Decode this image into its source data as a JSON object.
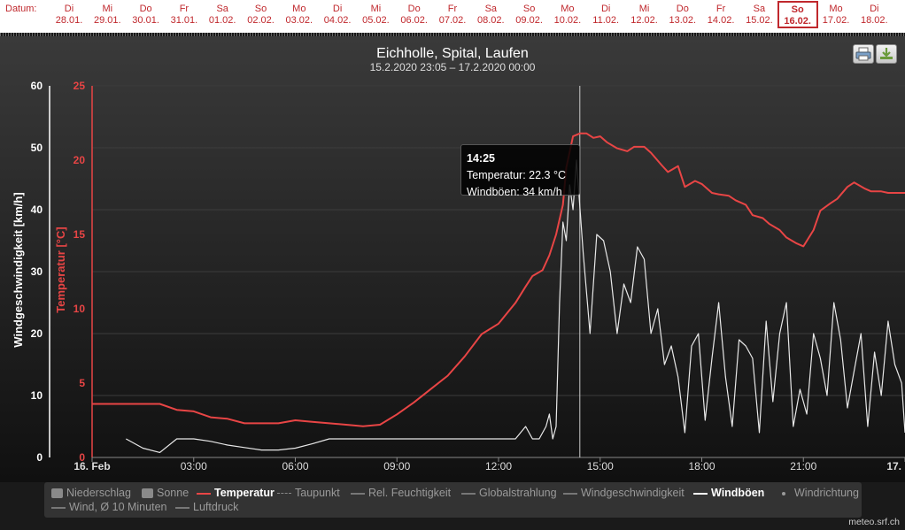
{
  "datebar": {
    "label": "Datum:",
    "days": [
      {
        "wd": "Di",
        "date": "28.01."
      },
      {
        "wd": "Mi",
        "date": "29.01."
      },
      {
        "wd": "Do",
        "date": "30.01."
      },
      {
        "wd": "Fr",
        "date": "31.01."
      },
      {
        "wd": "Sa",
        "date": "01.02."
      },
      {
        "wd": "So",
        "date": "02.02."
      },
      {
        "wd": "Mo",
        "date": "03.02."
      },
      {
        "wd": "Di",
        "date": "04.02."
      },
      {
        "wd": "Mi",
        "date": "05.02."
      },
      {
        "wd": "Do",
        "date": "06.02."
      },
      {
        "wd": "Fr",
        "date": "07.02."
      },
      {
        "wd": "Sa",
        "date": "08.02."
      },
      {
        "wd": "So",
        "date": "09.02."
      },
      {
        "wd": "Mo",
        "date": "10.02."
      },
      {
        "wd": "Di",
        "date": "11.02."
      },
      {
        "wd": "Mi",
        "date": "12.02."
      },
      {
        "wd": "Do",
        "date": "13.02."
      },
      {
        "wd": "Fr",
        "date": "14.02."
      },
      {
        "wd": "Sa",
        "date": "15.02."
      },
      {
        "wd": "So",
        "date": "16.02."
      },
      {
        "wd": "Mo",
        "date": "17.02."
      },
      {
        "wd": "Di",
        "date": "18.02."
      }
    ],
    "selected": "16.02."
  },
  "tooltip": {
    "time": "14:25",
    "line1": "Temperatur: 22.3 °C",
    "line2": "Windböen: 34 km/h"
  },
  "legend": [
    {
      "name": "Niederschlag",
      "marker": "box",
      "active": false
    },
    {
      "name": "Sonne",
      "marker": "box",
      "active": false
    },
    {
      "name": "Temperatur",
      "marker": "line",
      "color": "#e84545",
      "active": true
    },
    {
      "name": "Taupunkt",
      "marker": "dash",
      "active": false
    },
    {
      "name": "Rel. Feuchtigkeit",
      "marker": "line",
      "active": false
    },
    {
      "name": "Globalstrahlung",
      "marker": "line",
      "active": false
    },
    {
      "name": "Windgeschwindigkeit",
      "marker": "line",
      "active": false
    },
    {
      "name": "Windböen",
      "marker": "line",
      "color": "#ffffff",
      "active": true
    },
    {
      "name": "Windrichtung",
      "marker": "dot",
      "active": false
    },
    {
      "name": "Wind, Ø 10 Minuten",
      "marker": "line",
      "active": false
    },
    {
      "name": "Luftdruck",
      "marker": "line",
      "active": false
    }
  ],
  "source": "meteo.srf.ch",
  "colors": {
    "temperature": "#e84545",
    "gusts": "#e8e8e8",
    "background": "#1a1a1a"
  },
  "icons": [
    "printer-icon",
    "download-icon"
  ],
  "chart_data": {
    "type": "line",
    "title": "Eichholle, Spital, Laufen",
    "subtitle": "15.2.2020 23:05 – 17.2.2020 00:00",
    "x_ticks": [
      "16. Feb",
      "03:00",
      "06:00",
      "09:00",
      "12:00",
      "15:00",
      "18:00",
      "21:00",
      "17. Feb"
    ],
    "xlim_hours": [
      0,
      24
    ],
    "y_left_outer": {
      "label": "Windgeschwindigkeit [km/h]",
      "ticks": [
        0,
        10,
        20,
        30,
        40,
        50,
        60
      ],
      "range": [
        0,
        60
      ]
    },
    "y_left_inner": {
      "label": "Temperatur [°C]",
      "ticks": [
        0,
        5,
        10,
        15,
        20,
        25
      ],
      "range": [
        0,
        25
      ]
    },
    "crosshair_hour": 14.4,
    "series": [
      {
        "name": "Temperatur",
        "axis": "temperature",
        "x": [
          -0.4,
          0.5,
          1,
          1.5,
          2,
          2.5,
          3,
          3.5,
          4,
          4.5,
          5,
          5.5,
          6,
          6.5,
          7,
          7.5,
          8,
          8.5,
          9,
          9.5,
          10,
          10.5,
          11,
          11.5,
          12,
          12.5,
          12.8,
          13,
          13.3,
          13.5,
          13.7,
          13.9,
          14,
          14.2,
          14.4,
          14.6,
          14.8,
          15,
          15.2,
          15.5,
          15.8,
          16,
          16.3,
          16.5,
          16.8,
          17,
          17.3,
          17.5,
          17.8,
          18,
          18.3,
          18.5,
          18.8,
          19,
          19.3,
          19.5,
          19.8,
          20,
          20.3,
          20.5,
          20.8,
          21,
          21.3,
          21.5,
          21.8,
          22,
          22.3,
          22.5,
          22.8,
          23,
          23.3,
          23.5,
          24
        ],
        "y": [
          3.6,
          3.6,
          3.6,
          3.6,
          3.6,
          3.2,
          3.1,
          2.7,
          2.6,
          2.3,
          2.3,
          2.3,
          2.5,
          2.4,
          2.3,
          2.2,
          2.1,
          2.2,
          2.9,
          3.7,
          4.6,
          5.5,
          6.8,
          8.3,
          9.0,
          10.4,
          11.5,
          12.2,
          12.6,
          13.6,
          15.0,
          17.0,
          19.5,
          21.6,
          21.8,
          21.8,
          21.5,
          21.6,
          21.2,
          20.8,
          20.6,
          20.9,
          20.9,
          20.5,
          19.7,
          19.2,
          19.6,
          18.2,
          18.6,
          18.4,
          17.8,
          17.7,
          17.6,
          17.3,
          17.0,
          16.3,
          16.1,
          15.7,
          15.3,
          14.8,
          14.4,
          14.2,
          15.3,
          16.6,
          17.1,
          17.4,
          18.2,
          18.5,
          18.1,
          17.9,
          17.9,
          17.8,
          17.8
        ]
      },
      {
        "name": "Windböen",
        "axis": "wind",
        "x": [
          1,
          1.5,
          2,
          2.5,
          3,
          3.5,
          4,
          4.5,
          5,
          5.5,
          6,
          6.5,
          7,
          7.5,
          8,
          8.5,
          9,
          9.5,
          10,
          10.5,
          11,
          11.5,
          12,
          12.5,
          12.8,
          13,
          13.2,
          13.4,
          13.5,
          13.6,
          13.7,
          13.8,
          13.9,
          14,
          14.1,
          14.2,
          14.3,
          14.5,
          14.7,
          14.9,
          15.1,
          15.3,
          15.5,
          15.7,
          15.9,
          16.1,
          16.3,
          16.5,
          16.7,
          16.9,
          17.1,
          17.3,
          17.5,
          17.7,
          17.9,
          18.1,
          18.3,
          18.5,
          18.7,
          18.9,
          19.1,
          19.3,
          19.5,
          19.7,
          19.9,
          20.1,
          20.3,
          20.5,
          20.7,
          20.9,
          21.1,
          21.3,
          21.5,
          21.7,
          21.9,
          22.1,
          22.3,
          22.5,
          22.7,
          22.9,
          23.1,
          23.3,
          23.5,
          23.7,
          23.9,
          24
        ],
        "y": [
          3,
          1.5,
          0.8,
          3,
          3,
          2.6,
          2,
          1.6,
          1.2,
          1.2,
          1.5,
          2.2,
          3,
          3,
          3,
          3,
          3,
          3,
          3,
          3,
          3,
          3,
          3,
          3,
          5,
          3,
          3,
          5,
          7,
          3,
          5,
          25,
          38,
          35,
          44,
          40,
          48,
          33,
          20,
          36,
          35,
          30,
          20,
          28,
          25,
          34,
          32,
          20,
          24,
          15,
          18,
          13,
          4,
          18,
          20,
          6,
          16,
          25,
          13,
          5,
          19,
          18,
          16,
          4,
          22,
          9,
          20,
          25,
          5,
          11,
          7,
          20,
          16,
          10,
          25,
          19,
          8,
          14,
          20,
          5,
          17,
          10,
          22,
          15,
          12,
          4
        ]
      }
    ]
  }
}
